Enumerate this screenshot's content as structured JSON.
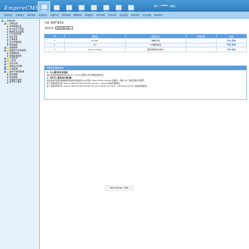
{
  "header": {
    "logo_text": "EmpireCMS",
    "user_label": "用户:",
    "user_name": "admin",
    "logout_label": "[退出]"
  },
  "top_nav": [
    {
      "label": "系统",
      "icon": "system-icon",
      "active": true
    },
    {
      "label": "信息",
      "icon": "info-icon"
    },
    {
      "label": "栏目",
      "icon": "column-icon"
    },
    {
      "label": "模板",
      "icon": "template-icon"
    },
    {
      "label": "用户",
      "icon": "user-icon"
    },
    {
      "label": "插件",
      "icon": "plugin-icon"
    },
    {
      "label": "商城",
      "icon": "shop-icon"
    },
    {
      "label": "其他",
      "icon": "other-icon"
    }
  ],
  "sub_nav": [
    "增加信息",
    "管理信息",
    "审核信息",
    "签发信息",
    "管理评论",
    "更新数据",
    "数据更新",
    "数据备份",
    "附件管理",
    "修改资料",
    "后台首页",
    "网站首页",
    "后台地图",
    "版本更新"
  ],
  "sidebar": {
    "items": [
      {
        "label": "系统设置",
        "kind": "folder",
        "level": 0
      },
      {
        "label": "系统设置",
        "kind": "folder",
        "level": 1
      },
      {
        "label": "系统参数设置",
        "kind": "page",
        "level": 2
      },
      {
        "label": "用户自定义页面",
        "kind": "page",
        "level": 2
      },
      {
        "label": "数据库与表管理",
        "kind": "page",
        "level": 2
      },
      {
        "label": "FTP设置管理",
        "kind": "page",
        "level": 2
      },
      {
        "label": "其它设置",
        "kind": "page",
        "level": 2
      },
      {
        "label": "扩展变量",
        "kind": "page",
        "level": 2
      },
      {
        "label": "安全参数配置",
        "kind": "page",
        "level": 2
      },
      {
        "label": "网站地图",
        "kind": "page",
        "level": 2
      },
      {
        "label": "数据更新",
        "kind": "folder",
        "level": 1
      },
      {
        "label": "数据表与系统模型",
        "kind": "folder",
        "level": 1
      },
      {
        "label": "管理数据表",
        "kind": "page",
        "level": 2
      },
      {
        "label": "管理系统模型",
        "kind": "page",
        "level": 2
      },
      {
        "label": "计划任务",
        "kind": "folder",
        "level": 1
      },
      {
        "label": "工作流",
        "kind": "folder",
        "level": 1
      },
      {
        "label": "优化方案",
        "kind": "folder",
        "level": 1
      },
      {
        "label": "网站多访问端",
        "kind": "folder",
        "level": 1
      },
      {
        "label": "扩展菜单",
        "kind": "folder",
        "level": 1
      },
      {
        "label": "备份与恢复数据",
        "kind": "folder",
        "level": 1
      },
      {
        "label": "备份数据",
        "kind": "page",
        "level": 2
      },
      {
        "label": "恢复数据",
        "kind": "page",
        "level": 2
      },
      {
        "label": "管理备份目录",
        "kind": "page",
        "level": 2
      },
      {
        "label": "执行SQL语句",
        "kind": "page",
        "level": 2
      }
    ]
  },
  "main": {
    "breadcrumb": "位置: 管理扩展变量",
    "filter_label": "选择分类:",
    "filter_value": "显示所有分类",
    "table": {
      "columns": [
        "ID",
        "变量名",
        "变量标识",
        "所属分类",
        "操作"
      ],
      "rows": [
        {
          "id": "3",
          "name": "hongbl",
          "desc": "微信代码",
          "cat": "",
          "action": "修改 删除"
        },
        {
          "id": "2",
          "name": "xhl",
          "desc": "ICP备案信息",
          "cat": "",
          "action": "修改 删除"
        },
        {
          "id": "1",
          "name": "home_classid",
          "desc": "首页调用的栏目ID",
          "cat": "",
          "action": "修改 删除"
        }
      ]
    },
    "help": {
      "title": "扩展变量调用说明",
      "lines": [
        {
          "text": "1、写入缓存的扩展变量:",
          "heading": true
        },
        {
          "text": "在后台调用或模板中用$public_r['add_变量名']方式调用变量内容。",
          "heading": false
        },
        {
          "text": "2、没有写入缓存的扩展变量:",
          "heading": true
        },
        {
          "text": "在后台用代码调用或模板中使用(灵动标签/php代码): ReturnPublicAddVar(变量名), 例如: 多个变量可用逗号隔开。",
          "heading": false
        },
        {
          "text": "单个变量调用示例: $value=ReturnPublicAddVar('myvar'); //$value就是变量的值。",
          "heading": false
        },
        {
          "text": "多个变量调用示例: $value=ReturnPublicAddVar('myvar1,myvar2,myvar3'); //$value['myvar1']就是变量的值。",
          "heading": false
        }
      ]
    }
  },
  "watermark": "mayublog.com",
  "colors": {
    "header_blue": "#1e6ab0",
    "table_head": "#5b9ddc",
    "sidebar_bg": "#e7f1fa"
  }
}
